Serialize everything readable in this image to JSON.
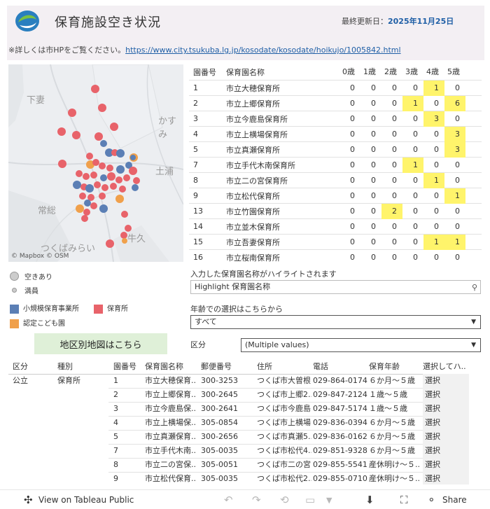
{
  "header": {
    "title": "保育施設空き状況",
    "updated_label": "最終更新日：",
    "updated_value": "2025年11月25日",
    "note_prefix": "※詳しくは市HPをご覧ください。",
    "note_link": "https://www.city.tsukuba.lg.jp/kosodate/kosodate/hoikujo/1005842.html"
  },
  "map": {
    "labels": [
      "下妻",
      "かすみ",
      "土浦",
      "常総",
      "牛久",
      "つくばみらい"
    ],
    "credit_mapbox": "© Mapbox",
    "credit_osm": "© OSM"
  },
  "legend": {
    "size": [
      "空きあり",
      "満員"
    ],
    "types": [
      {
        "label": "小規模保育事業所",
        "color": "#5b7fb5"
      },
      {
        "label": "保育所",
        "color": "#e8636a"
      },
      {
        "label": "認定こども園",
        "color": "#f0a04b"
      }
    ]
  },
  "area_button": "地区別地図はこちら",
  "vacancy_table": {
    "headers": [
      "園番号",
      "保育園名称",
      "0歳",
      "1歳",
      "2歳",
      "3歳",
      "4歳",
      "5歳"
    ],
    "rows": [
      {
        "no": "1",
        "name": "市立大穂保育所",
        "ages": [
          "0",
          "0",
          "0",
          "0",
          "1",
          "0"
        ]
      },
      {
        "no": "2",
        "name": "市立上郷保育所",
        "ages": [
          "0",
          "0",
          "0",
          "1",
          "0",
          "6"
        ]
      },
      {
        "no": "3",
        "name": "市立今鹿島保育所",
        "ages": [
          "0",
          "0",
          "0",
          "0",
          "3",
          "0"
        ]
      },
      {
        "no": "4",
        "name": "市立上横場保育所",
        "ages": [
          "0",
          "0",
          "0",
          "0",
          "0",
          "3"
        ]
      },
      {
        "no": "5",
        "name": "市立真瀬保育所",
        "ages": [
          "0",
          "0",
          "0",
          "0",
          "0",
          "3"
        ]
      },
      {
        "no": "7",
        "name": "市立手代木南保育所",
        "ages": [
          "0",
          "0",
          "0",
          "1",
          "0",
          "0"
        ]
      },
      {
        "no": "8",
        "name": "市立二の宮保育所",
        "ages": [
          "0",
          "0",
          "0",
          "0",
          "1",
          "0"
        ]
      },
      {
        "no": "9",
        "name": "市立松代保育所",
        "ages": [
          "0",
          "0",
          "0",
          "0",
          "0",
          "1"
        ]
      },
      {
        "no": "13",
        "name": "市立竹園保育所",
        "ages": [
          "0",
          "0",
          "2",
          "0",
          "0",
          "0"
        ]
      },
      {
        "no": "14",
        "name": "市立並木保育所",
        "ages": [
          "0",
          "0",
          "0",
          "0",
          "0",
          "0"
        ]
      },
      {
        "no": "15",
        "name": "市立吾妻保育所",
        "ages": [
          "0",
          "0",
          "0",
          "0",
          "1",
          "1"
        ]
      },
      {
        "no": "16",
        "name": "市立桜南保育所",
        "ages": [
          "0",
          "0",
          "0",
          "0",
          "0",
          "0"
        ]
      }
    ]
  },
  "controls": {
    "highlight_label": "入力した保育園名称がハイライトされます",
    "highlight_placeholder": "Highlight 保育園名称",
    "age_label": "年齢での選択はこちらから",
    "age_value": "すべて",
    "district_label": "区分",
    "district_value": "(Multiple values)"
  },
  "detail_table": {
    "headers": [
      "区分",
      "種別",
      "園番号",
      "保育園名称",
      "郵便番号",
      "住所",
      "電話",
      "保育年齢",
      "選択してハ.."
    ],
    "group_district": "公立",
    "group_type": "保育所",
    "rows": [
      {
        "no": "1",
        "name": "市立大穂保育..",
        "zip": "300-3253",
        "addr": "つくば市大曽根..",
        "tel": "029-864-0174",
        "age": "６か月～５歳",
        "sel": "選択"
      },
      {
        "no": "2",
        "name": "市立上郷保育..",
        "zip": "300-2645",
        "addr": "つくば市上郷2..",
        "tel": "029-847-2124",
        "age": "１歳～５歳",
        "sel": "選択"
      },
      {
        "no": "3",
        "name": "市立今鹿島保..",
        "zip": "300-2641",
        "addr": "つくば市今鹿島..",
        "tel": "029-847-5174",
        "age": "１歳～５歳",
        "sel": "選択"
      },
      {
        "no": "4",
        "name": "市立上横場保..",
        "zip": "305-0854",
        "addr": "つくば市上横場..",
        "tel": "029-836-0394",
        "age": "６か月～５歳",
        "sel": "選択"
      },
      {
        "no": "5",
        "name": "市立真瀬保育..",
        "zip": "300-2656",
        "addr": "つくば市真瀬5..",
        "tel": "029-836-0162",
        "age": "６か月～５歳",
        "sel": "選択"
      },
      {
        "no": "7",
        "name": "市立手代木南..",
        "zip": "305-0035",
        "addr": "つくば市松代4..",
        "tel": "029-851-9328",
        "age": "６か月～５歳",
        "sel": "選択"
      },
      {
        "no": "8",
        "name": "市立二の宮保..",
        "zip": "305-0051",
        "addr": "つくば市二の宮..",
        "tel": "029-855-5541",
        "age": "産休明け～５..",
        "sel": "選択"
      },
      {
        "no": "9",
        "name": "市立松代保育..",
        "zip": "305-0035",
        "addr": "つくば市松代2..",
        "tel": "029-855-0710",
        "age": "産休明け～５..",
        "sel": "選択"
      }
    ]
  },
  "footer": {
    "view_label": "View on Tableau Public",
    "share_label": "Share"
  }
}
